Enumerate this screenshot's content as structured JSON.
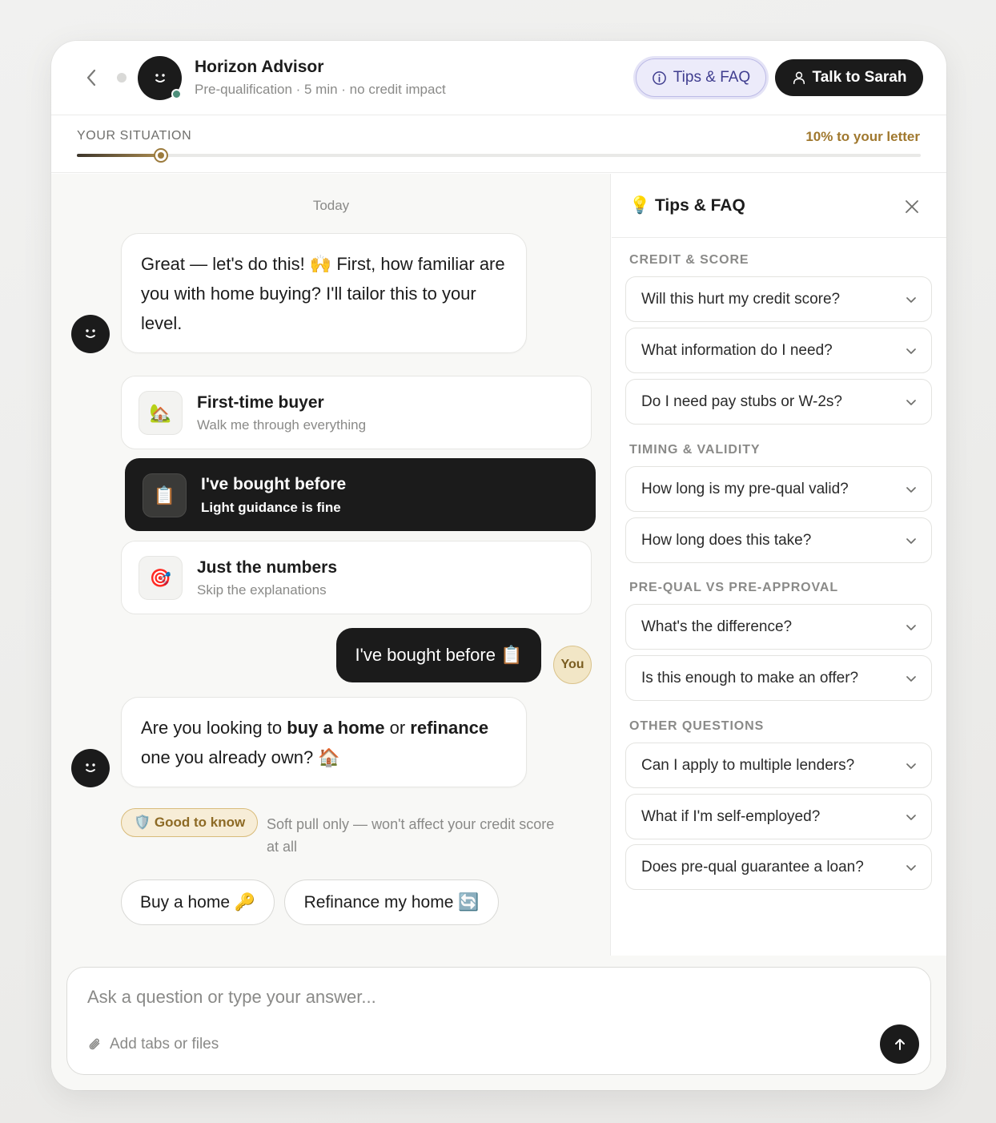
{
  "header": {
    "title": "Horizon Advisor",
    "subtitle": "Pre-qualification · 5 min · no credit impact",
    "tips_label": "Tips & FAQ",
    "talk_label": "Talk to Sarah"
  },
  "progress": {
    "label": "YOUR SITUATION",
    "status": "10% to your letter",
    "value_percent": 10
  },
  "chat": {
    "day_label": "Today",
    "messages": {
      "intro": "Great — let's do this! 🙌 First, how familiar are you with home buying? I'll tailor this to your level.",
      "q2_parts": [
        "Are you looking to ",
        "buy a home",
        " or ",
        "refinance",
        " one you already own? 🏠"
      ],
      "user_reply": "I've bought before 📋",
      "user_badge": "You"
    },
    "options": [
      {
        "title": "First-time buyer",
        "subtitle": "Walk me through everything",
        "icon": "🏡",
        "selected": false
      },
      {
        "title": "I've bought before",
        "subtitle": "Light guidance is fine",
        "icon": "📋",
        "selected": true
      },
      {
        "title": "Just the numbers",
        "subtitle": "Skip the explanations",
        "icon": "🎯",
        "selected": false
      }
    ],
    "good_to_know": {
      "badge": "🛡️ Good to know",
      "text": "Soft pull only — won't affect your credit score at all"
    },
    "quick_replies": [
      "Buy a home 🔑",
      "Refinance my home 🔄"
    ]
  },
  "side_panel": {
    "title": "💡 Tips & FAQ",
    "sections": [
      {
        "label": "CREDIT & SCORE",
        "questions": [
          "Will this hurt my credit score?",
          "What information do I need?",
          "Do I need pay stubs or W-2s?"
        ]
      },
      {
        "label": "TIMING & VALIDITY",
        "questions": [
          "How long is my pre-qual valid?",
          "How long does this take?"
        ]
      },
      {
        "label": "PRE-QUAL VS PRE-APPROVAL",
        "questions": [
          "What's the difference?",
          "Is this enough to make an offer?"
        ]
      },
      {
        "label": "OTHER QUESTIONS",
        "questions": [
          "Can I apply to multiple lenders?",
          "What if I'm self-employed?",
          "Does pre-qual guarantee a loan?"
        ]
      }
    ]
  },
  "composer": {
    "placeholder": "Ask a question or type your answer...",
    "attach_label": "Add tabs or files"
  },
  "colors": {
    "accent_gold": "#a0782e",
    "dark": "#1b1b1b",
    "online": "#4e8f7b",
    "tips_purple": "#3f3d8f"
  }
}
